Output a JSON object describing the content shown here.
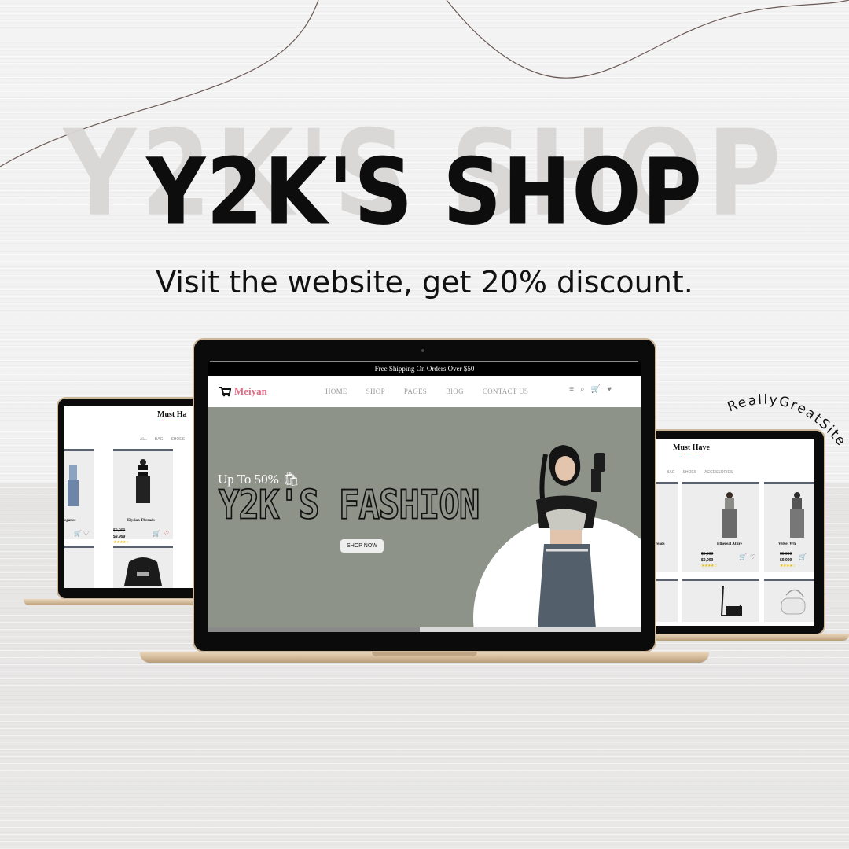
{
  "poster": {
    "title": "Y2K'S SHOP",
    "title_shadow": "Y2K'S SHOP",
    "subtitle": "Visit the website, get 20% discount.",
    "badge": "ReallyGreatSite"
  },
  "main_site": {
    "announcement": "Free Shipping On Orders Over $50",
    "logo": "Meiyan",
    "nav": [
      "HOME",
      "SHOP",
      "PAGES",
      "BlOG",
      "CONTACT US"
    ],
    "header_icons": [
      "menu-icon",
      "search-icon",
      "cart-icon",
      "heart-icon"
    ],
    "hero": {
      "eyebrow": "Up To 50%",
      "headline": "Y2K'S FASHION",
      "button": "SHOP NOW"
    },
    "scroll_progress": 0.49
  },
  "left_site": {
    "title": "Must Ha",
    "categories": [
      "ALL",
      "BAG",
      "SHOES"
    ],
    "products": [
      {
        "name": "egance",
        "old_price": "",
        "price": ""
      },
      {
        "name": "Elysian Threads",
        "old_price": "$9,999",
        "price": "$9,999"
      }
    ]
  },
  "right_site": {
    "title": "Must Have",
    "categories": [
      "BAG",
      "SHOES",
      "ACCESSORIES"
    ],
    "products": [
      {
        "name": "reads",
        "old_price": "",
        "price": ""
      },
      {
        "name": "Ethereal Attire",
        "old_price": "$9,999",
        "price": "$9,999"
      },
      {
        "name": "Velvet Wh",
        "old_price": "$9,999",
        "price": "$9,999"
      }
    ]
  },
  "colors": {
    "logo_pink": "#e36b86",
    "hero_bg": "#8e938a",
    "laptop_gold": "#d7bf9f",
    "heart_red": "#d0202e",
    "stars": "#e8c000"
  }
}
